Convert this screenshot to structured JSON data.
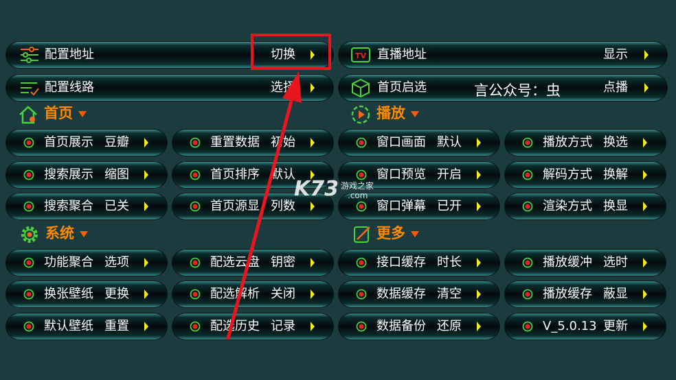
{
  "top_rows": [
    {
      "label": "配置地址",
      "value": "切换",
      "icon": "sliders-icon"
    },
    {
      "label": "直播地址",
      "value": "显示",
      "icon": "tv-icon"
    },
    {
      "label": "配置线路",
      "value": "选择",
      "icon": "checklist-icon"
    },
    {
      "label": "首页启选",
      "value": "点播",
      "icon": "cube-icon"
    }
  ],
  "sections": {
    "home": {
      "title": "首页",
      "icon": "home-icon"
    },
    "play": {
      "title": "播放",
      "icon": "play-circle-icon"
    },
    "system": {
      "title": "系统",
      "icon": "gear-icon"
    },
    "more": {
      "title": "更多",
      "icon": "edit-icon"
    }
  },
  "home_items": [
    {
      "label": "首页展示",
      "value": "豆瓣"
    },
    {
      "label": "重置数据",
      "value": "初始"
    },
    {
      "label": "搜索展示",
      "value": "缩图"
    },
    {
      "label": "首页排序",
      "value": "默认"
    },
    {
      "label": "搜索聚合",
      "value": "已关"
    },
    {
      "label": "首页源显",
      "value": "列数"
    }
  ],
  "play_items": [
    {
      "label": "窗口画面",
      "value": "默认"
    },
    {
      "label": "播放方式",
      "value": "换选"
    },
    {
      "label": "窗口预览",
      "value": "开启"
    },
    {
      "label": "解码方式",
      "value": "换解"
    },
    {
      "label": "窗口弹幕",
      "value": "已开"
    },
    {
      "label": "渲染方式",
      "value": "换显"
    }
  ],
  "system_items": [
    {
      "label": "功能聚合",
      "value": "选项"
    },
    {
      "label": "配选云盘",
      "value": "钥密"
    },
    {
      "label": "换张壁纸",
      "value": "更换"
    },
    {
      "label": "配选解析",
      "value": "关闭"
    },
    {
      "label": "默认壁纸",
      "value": "重置"
    },
    {
      "label": "配选历史",
      "value": "记录"
    }
  ],
  "more_items": [
    {
      "label": "接口缓存",
      "value": "时长"
    },
    {
      "label": "播放缓冲",
      "value": "选时"
    },
    {
      "label": "数据缓存",
      "value": "清空"
    },
    {
      "label": "播放缓存",
      "value": "蔽显"
    },
    {
      "label": "数据备份",
      "value": "还原"
    },
    {
      "label": "V_5.0.13",
      "value": "更新"
    }
  ],
  "overlay": {
    "public_account_text": "言公众号：虫",
    "watermark_logo": "K73",
    "watermark_cn": "游戏之家",
    "watermark_com": ".com"
  },
  "colors": {
    "background": "#1c3b3f",
    "arrow": "#f3ec1c",
    "section_title": "#ff8a00",
    "highlight_box": "#e8161e",
    "annotation_arrow": "#e8161e",
    "radio_dot": "#e8261e"
  }
}
